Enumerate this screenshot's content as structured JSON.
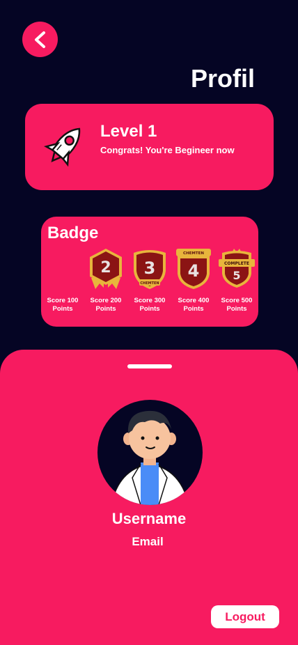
{
  "header": {
    "back_icon": "chevron-left-icon",
    "title": "Profil"
  },
  "level": {
    "icon": "rocket-icon",
    "title": "Level 1",
    "message": "Congrats! You're Begineer now"
  },
  "badges": {
    "title": "Badge",
    "items": [
      {
        "number": "",
        "ribbon": "",
        "caption": "Score 100\nPoints"
      },
      {
        "number": "2",
        "ribbon": "",
        "caption": "Score 200\nPoints"
      },
      {
        "number": "3",
        "ribbon": "CHEMTEN",
        "caption": "Score 300\nPoints"
      },
      {
        "number": "4",
        "ribbon": "CHEMTEN",
        "caption": "Score 400\nPoints"
      },
      {
        "number": "5",
        "ribbon": "COMPLETE",
        "caption": "Score 500\nPoints"
      }
    ]
  },
  "profile": {
    "username": "Username",
    "email": "Email",
    "logout_label": "Logout"
  },
  "colors": {
    "background": "#050524",
    "accent": "#f71b60",
    "badge_red": "#8b1414",
    "badge_gold": "#e8b53c"
  }
}
